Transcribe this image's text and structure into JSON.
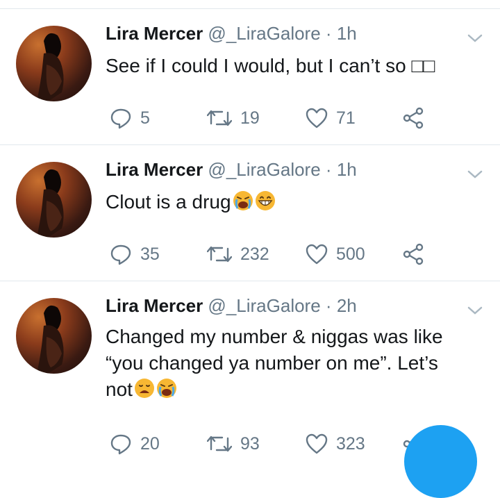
{
  "tweets": [
    {
      "name": "Lira Mercer",
      "handle": "@_LiraGalore",
      "dot": "·",
      "time": "1h",
      "text": "See if I could I would, but I can’t so ",
      "emoji_suffix": "□□",
      "replies": "5",
      "retweets": "19",
      "likes": "71"
    },
    {
      "name": "Lira Mercer",
      "handle": "@_LiraGalore",
      "dot": "·",
      "time": "1h",
      "text": "Clout is a drug",
      "emojis": [
        "crying-face-icon",
        "grinning-face-icon"
      ],
      "replies": "35",
      "retweets": "232",
      "likes": "500"
    },
    {
      "name": "Lira Mercer",
      "handle": "@_LiraGalore",
      "dot": "·",
      "time": "2h",
      "text_lines": [
        "Changed my number & niggas was like",
        "“you changed ya number on me”.  Let’s",
        "not"
      ],
      "emojis": [
        "sad-face-icon",
        "crying-face-icon"
      ],
      "replies": "20",
      "retweets": "93",
      "likes": "323"
    }
  ],
  "colors": {
    "text": "#14171a",
    "muted": "#657786",
    "divider": "#e1e8ed",
    "accent": "#1da1f2"
  }
}
